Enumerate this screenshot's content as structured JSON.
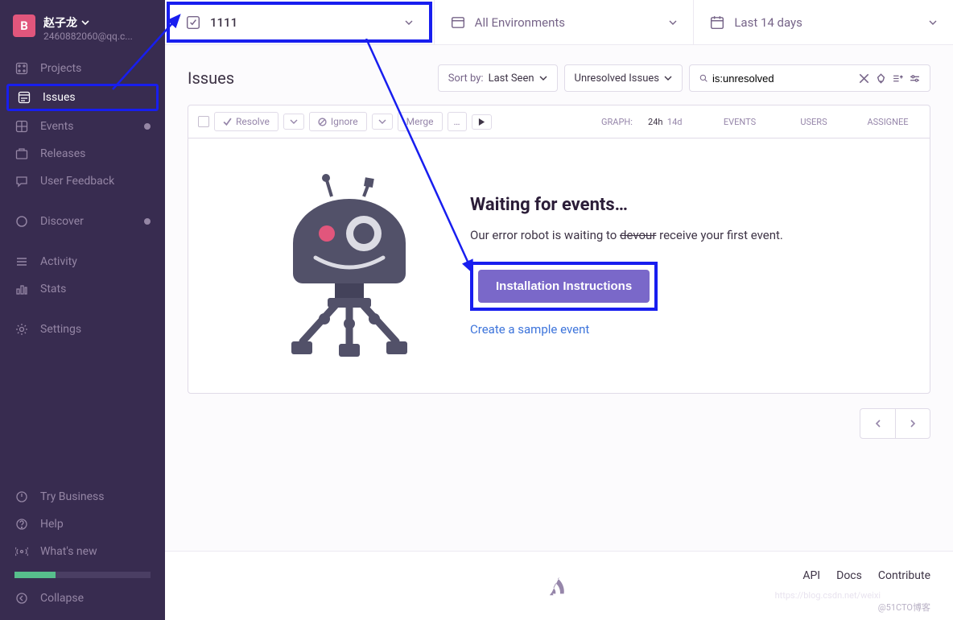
{
  "user": {
    "avatar": "B",
    "name": "赵子龙",
    "email": "2460882060@qq.c..."
  },
  "nav": {
    "projects": "Projects",
    "issues": "Issues",
    "events": "Events",
    "releases": "Releases",
    "user_feedback": "User Feedback",
    "discover": "Discover",
    "activity": "Activity",
    "stats": "Stats",
    "settings": "Settings",
    "try_business": "Try Business",
    "help": "Help",
    "whats_new": "What's new",
    "collapse": "Collapse"
  },
  "topbar": {
    "project": "1111",
    "env": "All Environments",
    "time": "Last 14 days"
  },
  "page": {
    "title": "Issues",
    "sort_label": "Sort by:",
    "sort_value": "Last Seen",
    "filter": "Unresolved Issues",
    "search_value": "is:unresolved"
  },
  "toolbar": {
    "resolve": "Resolve",
    "ignore": "Ignore",
    "merge": "Merge",
    "more": "…",
    "graph": "GRAPH:",
    "h24": "24h",
    "d14": "14d",
    "events": "EVENTS",
    "users": "USERS",
    "assignee": "ASSIGNEE"
  },
  "empty": {
    "title": "Waiting for events…",
    "p1": "Our error robot is waiting to ",
    "strike": "devour",
    "p2": " receive your first event.",
    "cta": "Installation Instructions",
    "sample": "Create a sample event"
  },
  "footer": {
    "api": "API",
    "docs": "Docs",
    "contribute": "Contribute",
    "wm": "@51CTO博客",
    "wm2": "https://blog.csdn.net/weixi"
  }
}
